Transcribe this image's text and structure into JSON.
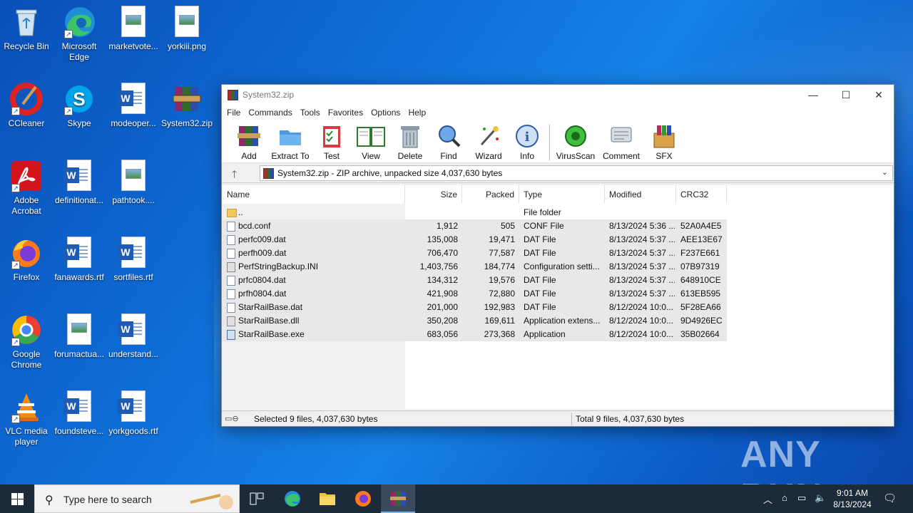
{
  "desktop": {
    "icons": [
      {
        "label": "Recycle Bin"
      },
      {
        "label": "Microsoft Edge"
      },
      {
        "label": "marketvote..."
      },
      {
        "label": "yorkiii.png"
      },
      {
        "label": "CCleaner"
      },
      {
        "label": "Skype"
      },
      {
        "label": "modeoper..."
      },
      {
        "label": "System32.zip"
      },
      {
        "label": "Adobe Acrobat"
      },
      {
        "label": "definitionat..."
      },
      {
        "label": "pathtook...."
      },
      {
        "label": "Firefox"
      },
      {
        "label": "fanawards.rtf"
      },
      {
        "label": "sortfiles.rtf"
      },
      {
        "label": "Google Chrome"
      },
      {
        "label": "forumactua..."
      },
      {
        "label": "understand..."
      },
      {
        "label": "VLC media player"
      },
      {
        "label": "foundsteve..."
      },
      {
        "label": "yorkgoods.rtf"
      }
    ]
  },
  "window": {
    "title": "System32.zip",
    "menu": [
      "File",
      "Commands",
      "Tools",
      "Favorites",
      "Options",
      "Help"
    ],
    "toolbar": [
      "Add",
      "Extract To",
      "Test",
      "View",
      "Delete",
      "Find",
      "Wizard",
      "Info",
      "VirusScan",
      "Comment",
      "SFX"
    ],
    "address": "System32.zip - ZIP archive, unpacked size 4,037,630 bytes",
    "columns": [
      "Name",
      "Size",
      "Packed",
      "Type",
      "Modified",
      "CRC32"
    ],
    "files": [
      {
        "name": "..",
        "size": "",
        "packed": "",
        "type": "File folder",
        "modified": "",
        "crc": "",
        "icon": "folder"
      },
      {
        "name": "bcd.conf",
        "size": "1,912",
        "packed": "505",
        "type": "CONF File",
        "modified": "8/13/2024 5:36 ...",
        "crc": "52A0A4E5",
        "icon": "file"
      },
      {
        "name": "perfc009.dat",
        "size": "135,008",
        "packed": "19,471",
        "type": "DAT File",
        "modified": "8/13/2024 5:37 ...",
        "crc": "AEE13E67",
        "icon": "file"
      },
      {
        "name": "perfh009.dat",
        "size": "706,470",
        "packed": "77,587",
        "type": "DAT File",
        "modified": "8/13/2024 5:37 ...",
        "crc": "F237E661",
        "icon": "file"
      },
      {
        "name": "PerfStringBackup.INI",
        "size": "1,403,756",
        "packed": "184,774",
        "type": "Configuration setti...",
        "modified": "8/13/2024 5:37 ...",
        "crc": "07B97319",
        "icon": "cfg"
      },
      {
        "name": "prfc0804.dat",
        "size": "134,312",
        "packed": "19,576",
        "type": "DAT File",
        "modified": "8/13/2024 5:37 ...",
        "crc": "648910CE",
        "icon": "file"
      },
      {
        "name": "prfh0804.dat",
        "size": "421,908",
        "packed": "72,880",
        "type": "DAT File",
        "modified": "8/13/2024 5:37 ...",
        "crc": "613EB595",
        "icon": "file"
      },
      {
        "name": "StarRailBase.dat",
        "size": "201,000",
        "packed": "192,983",
        "type": "DAT File",
        "modified": "8/12/2024 10:0...",
        "crc": "5F28EA66",
        "icon": "file"
      },
      {
        "name": "StarRailBase.dll",
        "size": "350,208",
        "packed": "169,611",
        "type": "Application extens...",
        "modified": "8/12/2024 10:0...",
        "crc": "9D4926EC",
        "icon": "cfg"
      },
      {
        "name": "StarRailBase.exe",
        "size": "683,056",
        "packed": "273,368",
        "type": "Application",
        "modified": "8/12/2024 10:0...",
        "crc": "35B02664",
        "icon": "exe"
      }
    ],
    "status_left": "Selected 9 files, 4,037,630 bytes",
    "status_right": "Total 9 files, 4,037,630 bytes"
  },
  "taskbar": {
    "search_placeholder": "Type here to search",
    "time": "9:01 AM",
    "date": "8/13/2024"
  },
  "watermark": "ANY RUN"
}
